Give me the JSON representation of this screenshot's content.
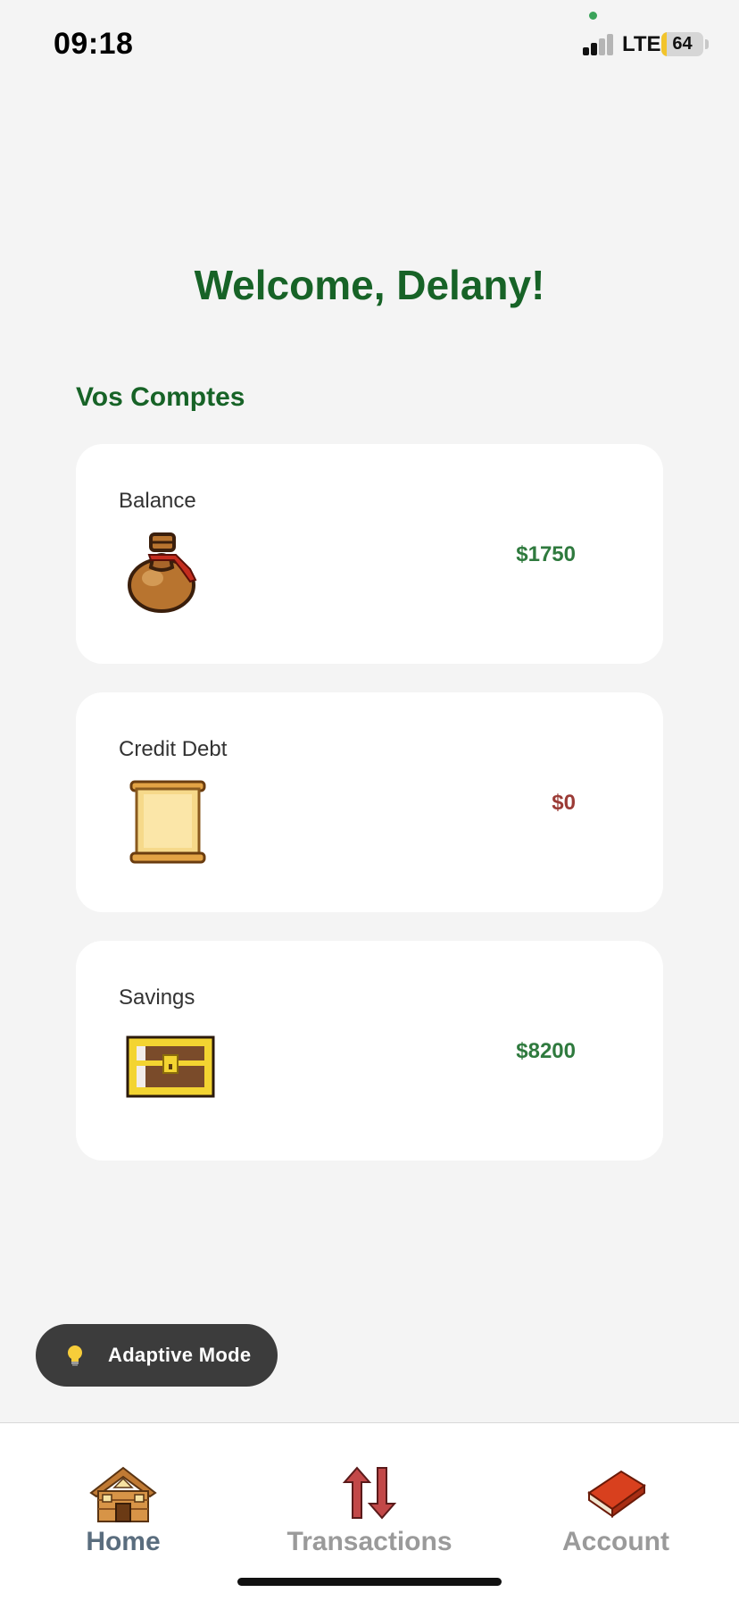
{
  "status_bar": {
    "time": "09:18",
    "network": "LTE",
    "battery": "64"
  },
  "header": {
    "welcome": "Welcome, Delany!"
  },
  "accounts": {
    "title": "Vos Comptes",
    "items": [
      {
        "label": "Balance",
        "amount": "$1750",
        "icon": "money-bag-icon",
        "amount_color": "#2f7a3e"
      },
      {
        "label": "Credit Debt",
        "amount": "$0",
        "icon": "scroll-icon",
        "amount_color": "#9b3b36"
      },
      {
        "label": "Savings",
        "amount": "$8200",
        "icon": "treasure-chest-icon",
        "amount_color": "#2f7a3e"
      }
    ]
  },
  "adaptive_mode": {
    "label": "Adaptive Mode",
    "icon": "lightbulb-icon"
  },
  "tabs": [
    {
      "label": "Home",
      "icon": "house-icon",
      "active": true
    },
    {
      "label": "Transactions",
      "icon": "up-down-arrows-icon",
      "active": false
    },
    {
      "label": "Account",
      "icon": "book-icon",
      "active": false
    }
  ],
  "colors": {
    "accent": "#176327",
    "positive": "#2f7a3e",
    "negative": "#9b3b36",
    "background": "#f4f4f4"
  }
}
